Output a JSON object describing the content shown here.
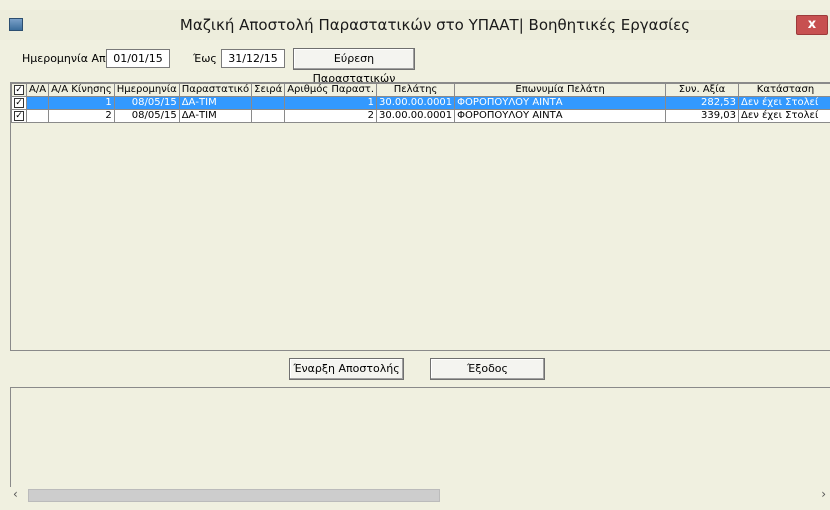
{
  "window": {
    "title": "Μαζική Αποστολή Παραστατικών στο ΥΠΑΑΤ| Βοηθητικές Εργασίες",
    "close_label": "x"
  },
  "filter": {
    "date_from_label": "Ημερομηνία Από",
    "date_from_value": "01/01/15",
    "date_to_label": "Έως",
    "date_to_value": "31/12/15",
    "search_button": "Εύρεση Παραστατικών"
  },
  "grid": {
    "columns": [
      "",
      "Α/Α",
      "Α/Α Κίνησης",
      "Ημερομηνία",
      "Παραστατικό",
      "Σειρά",
      "Αριθμός Παραστ.",
      "Πελάτης",
      "Επωνυμία Πελάτη",
      "Συν. Αξία",
      "Κατάσταση"
    ],
    "rows": [
      {
        "aa": "",
        "aa_kinisis": "1",
        "date": "08/05/15",
        "doc": "ΔΑ-ΤΙΜ",
        "series": "",
        "doc_no": "1",
        "customer": "30.00.00.0001",
        "customer_name": "ΦΟΡΟΠΟΥΛΟΥ ΑΙΝΤΑ",
        "total": "282,53",
        "status": "Δεν έχει Στολεί",
        "checked": true,
        "selected": true
      },
      {
        "aa": "",
        "aa_kinisis": "2",
        "date": "08/05/15",
        "doc": "ΔΑ-ΤΙΜ",
        "series": "",
        "doc_no": "2",
        "customer": "30.00.00.0001",
        "customer_name": "ΦΟΡΟΠΟΥΛΟΥ ΑΙΝΤΑ",
        "total": "339,03",
        "status": "Δεν έχει Στολεί",
        "checked": true,
        "selected": false
      }
    ]
  },
  "actions": {
    "start_button": "Έναρξη Αποστολής",
    "exit_button": "Έξοδος"
  }
}
